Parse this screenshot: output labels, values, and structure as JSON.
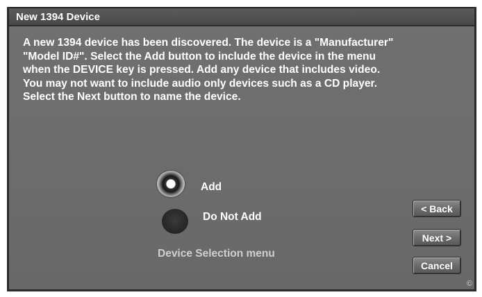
{
  "dialog": {
    "title": "New 1394 Device",
    "message": "A new 1394 device has been discovered. The device is a \"Manufacturer\"\n\"Model ID#\".  Select the Add button to include the device in the menu\nwhen the DEVICE key is pressed.   Add any device that includes video.\nYou may not want to include audio only devices such as a CD player.\nSelect the Next button to name the device.",
    "options": [
      {
        "label": "Add",
        "selected": true
      },
      {
        "label": "Do Not Add",
        "selected": false
      }
    ],
    "caption": "Device Selection menu",
    "buttons": {
      "back": "< Back",
      "next": "Next >",
      "cancel": "Cancel"
    },
    "copyright_mark": "©"
  },
  "colors": {
    "panel": "#6c6c6c",
    "titlebar": "#4f4f4f",
    "text": "#ffffff",
    "caption": "#cfcfcf"
  },
  "icons": {
    "selected_radio": "radio-selected-icon",
    "unselected_radio": "radio-unselected-icon"
  }
}
